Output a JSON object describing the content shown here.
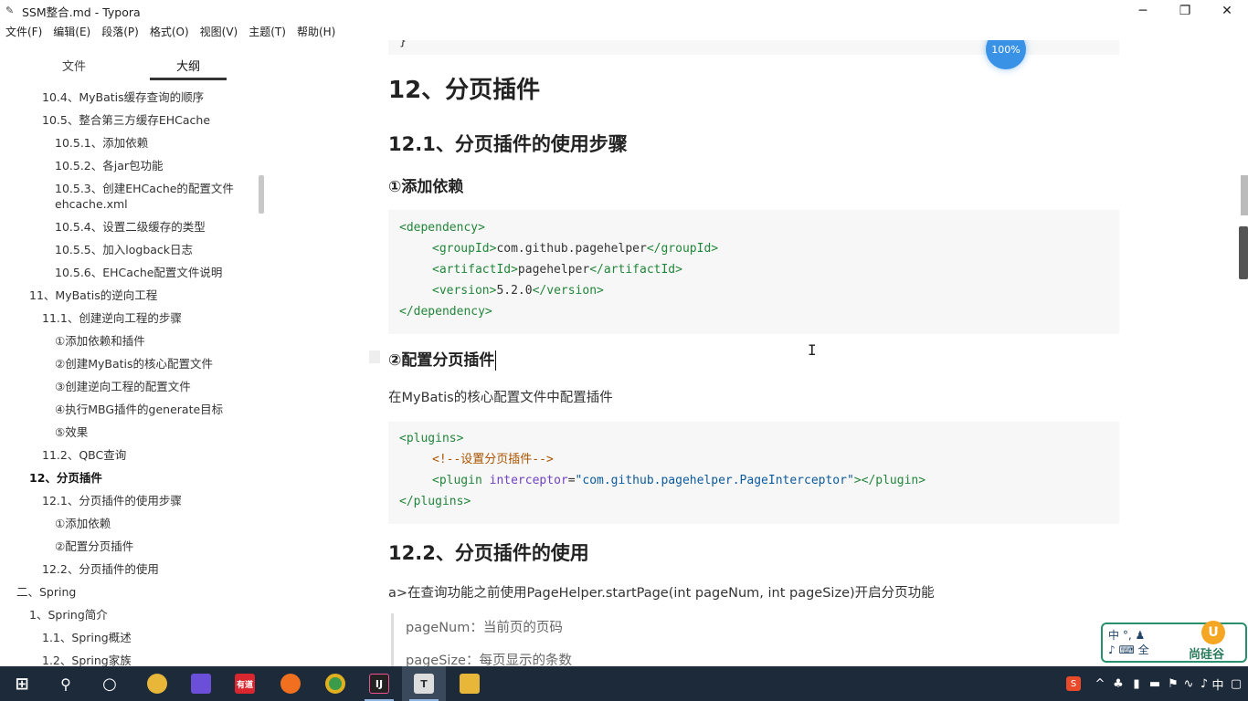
{
  "window": {
    "title": "SSM整合.md - Typora",
    "controls": {
      "minimize": "─",
      "restore": "❐",
      "close": "✕"
    }
  },
  "menu": [
    "文件(F)",
    "编辑(E)",
    "段落(P)",
    "格式(O)",
    "视图(V)",
    "主题(T)",
    "帮助(H)"
  ],
  "sidebar": {
    "tabs": [
      "文件",
      "大纲"
    ],
    "active_tab": "大纲",
    "outline": [
      {
        "label": "10.4、MyBatis缓存查询的顺序",
        "level": 3
      },
      {
        "label": "10.5、整合第三方缓存EHCache",
        "level": 3
      },
      {
        "label": "10.5.1、添加依赖",
        "level": 4
      },
      {
        "label": "10.5.2、各jar包功能",
        "level": 4
      },
      {
        "label": "10.5.3、创建EHCache的配置文件",
        "level": 4
      },
      {
        "label": "ehcache.xml",
        "level": 4
      },
      {
        "label": "10.5.4、设置二级缓存的类型",
        "level": 4
      },
      {
        "label": "10.5.5、加入logback日志",
        "level": 4
      },
      {
        "label": "10.5.6、EHCache配置文件说明",
        "level": 4
      },
      {
        "label": "11、MyBatis的逆向工程",
        "level": 2
      },
      {
        "label": "11.1、创建逆向工程的步骤",
        "level": 3
      },
      {
        "label": "①添加依赖和插件",
        "level": 4
      },
      {
        "label": "②创建MyBatis的核心配置文件",
        "level": 4
      },
      {
        "label": "③创建逆向工程的配置文件",
        "level": 4
      },
      {
        "label": "④执行MBG插件的generate目标",
        "level": 4
      },
      {
        "label": "⑤效果",
        "level": 4
      },
      {
        "label": "11.2、QBC查询",
        "level": 3
      },
      {
        "label": "12、分页插件",
        "level": 2,
        "active": true
      },
      {
        "label": "12.1、分页插件的使用步骤",
        "level": 3
      },
      {
        "label": "①添加依赖",
        "level": 4
      },
      {
        "label": "②配置分页插件",
        "level": 4
      },
      {
        "label": "12.2、分页插件的使用",
        "level": 3
      },
      {
        "label": "二、Spring",
        "level": 1
      },
      {
        "label": "1、Spring简介",
        "level": 2
      },
      {
        "label": "1.1、Spring概述",
        "level": 3
      },
      {
        "label": "1.2、Spring家族",
        "level": 3
      }
    ],
    "footer": "‹    </>"
  },
  "editor": {
    "top_brace": "}",
    "zoom": "100%",
    "h1": "12、分页插件",
    "h2_a": "12.1、分页插件的使用步骤",
    "h3_a": "①添加依赖",
    "code1": {
      "l1_open": "<dependency>",
      "l2_open": "<groupId>",
      "l2_text": "com.github.pagehelper",
      "l2_close": "</groupId>",
      "l3_open": "<artifactId>",
      "l3_text": "pagehelper",
      "l3_close": "</artifactId>",
      "l4_open": "<version>",
      "l4_text": "5.2.0",
      "l4_close": "</version>",
      "l5_close": "</dependency>"
    },
    "h3_b": "②配置分页插件",
    "para1": "在MyBatis的核心配置文件中配置插件",
    "code2": {
      "l1": "<plugins>",
      "l2": "<!--设置分页插件-->",
      "l3_open": "<plugin ",
      "l3_attr": "interceptor",
      "l3_eq": "=",
      "l3_val": "\"com.github.pagehelper.PageInterceptor\"",
      "l3_close": "></plugin>",
      "l4": "</plugins>"
    },
    "h2_b": "12.2、分页插件的使用",
    "para2": "a>在查询功能之前使用PageHelper.startPage(int pageNum, int pageSize)开启分页功能",
    "quote": [
      "pageNum：当前页的页码",
      "pageSize：每页显示的条数"
    ]
  },
  "ime": {
    "line1": "中 °,  ♟",
    "line2": "♪ ⌨ 全",
    "brand": "尚硅谷",
    "logo": "U"
  },
  "taskbar": {
    "apps": [
      {
        "name": "start",
        "glyph": "⊞",
        "color": "#1c2a3a"
      },
      {
        "name": "search",
        "glyph": "⚲",
        "color": "#1c2a3a"
      },
      {
        "name": "cortana",
        "glyph": "○",
        "color": "#1c2a3a"
      },
      {
        "name": "app-yellow",
        "glyph": "",
        "color": "#e8b73a"
      },
      {
        "name": "app-purple",
        "glyph": "",
        "color": "#6b4fd8"
      },
      {
        "name": "app-red",
        "glyph": "有道",
        "color": "#d9262f"
      },
      {
        "name": "firefox",
        "glyph": "",
        "color": "#f07020"
      },
      {
        "name": "chrome",
        "glyph": "",
        "color": "#3a9b4a"
      },
      {
        "name": "intellij",
        "glyph": "IJ",
        "color": "#222"
      },
      {
        "name": "typora",
        "glyph": "T",
        "color": "#ddd"
      },
      {
        "name": "explorer",
        "glyph": "",
        "color": "#e8b73a"
      }
    ],
    "tray": [
      "S",
      "^",
      "♣",
      "▮",
      "▬",
      "⚑",
      "∿",
      "♪",
      "中",
      "▢"
    ]
  }
}
